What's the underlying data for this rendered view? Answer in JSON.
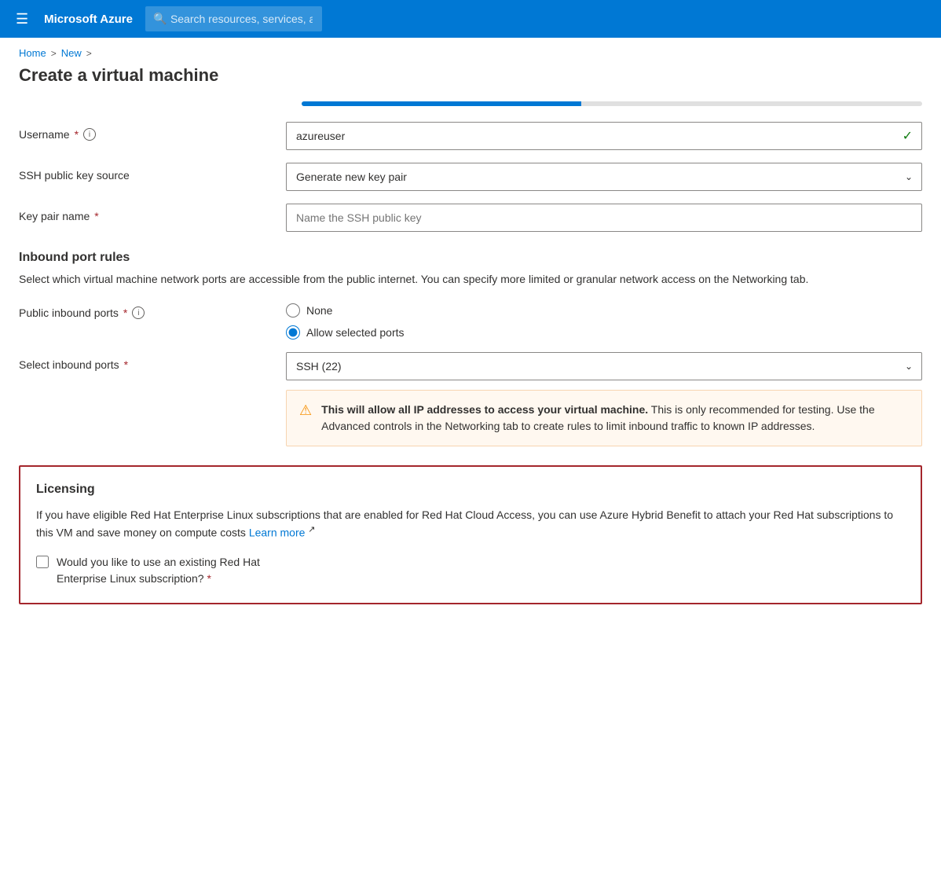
{
  "topbar": {
    "hamburger_icon": "☰",
    "logo": "Microsoft Azure",
    "search_placeholder": "Search resources, services, and docs (G+/)"
  },
  "breadcrumb": {
    "home": "Home",
    "new": "New",
    "sep1": ">",
    "sep2": ">"
  },
  "page": {
    "title": "Create a virtual machine"
  },
  "form": {
    "username_label": "Username",
    "username_value": "azureuser",
    "username_check": "✓",
    "ssh_source_label": "SSH public key source",
    "ssh_source_value": "Generate new key pair",
    "key_pair_label": "Key pair name",
    "key_pair_placeholder": "Name the SSH public key"
  },
  "inbound": {
    "section_title": "Inbound port rules",
    "section_desc": "Select which virtual machine network ports are accessible from the public internet. You can specify more limited or granular network access on the Networking tab.",
    "public_ports_label": "Public inbound ports",
    "none_label": "None",
    "allow_selected_label": "Allow selected ports",
    "select_ports_label": "Select inbound ports",
    "select_ports_value": "SSH (22)",
    "warning_bold": "This will allow all IP addresses to access your virtual machine.",
    "warning_rest": " This is only recommended for testing.  Use the Advanced controls in the Networking tab to create rules to limit inbound traffic to known IP addresses."
  },
  "licensing": {
    "title": "Licensing",
    "desc": "If you have eligible Red Hat Enterprise Linux subscriptions that are enabled for Red Hat Cloud Access, you can use Azure Hybrid Benefit to attach your Red Hat subscriptions to this VM and save money on compute costs  ",
    "learn_more": "Learn more",
    "external_icon": "↗",
    "checkbox_label_line1": "Would you like to use an existing Red Hat",
    "checkbox_label_line2": "Enterprise Linux subscription?",
    "required_star": "*"
  },
  "icons": {
    "search": "🔍",
    "chevron_down": "⌄",
    "info": "i",
    "check": "✓",
    "warning": "⚠"
  }
}
